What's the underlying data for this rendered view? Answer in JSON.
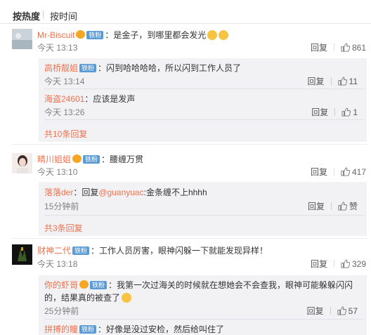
{
  "tabs": {
    "hot": "按热度",
    "time": "按时间"
  },
  "icons": {
    "like": "thumbs-up-icon",
    "verified": "vip-badge-icon",
    "emoji": "emoji-icon"
  },
  "colors": {
    "username": "#eb7350",
    "badge": "#5b9bd5",
    "reply_bg": "#f2f2f5"
  },
  "comments": [
    {
      "user": "Mr-Biscuit",
      "badge": "铁粉",
      "text": "：是金子，到哪里都会发光",
      "time": "今天 13:13",
      "reply": "回复",
      "likes": "861",
      "replies": [
        {
          "user": "高桥靓姐",
          "badge": "铁粉",
          "text": "：闪到哈哈哈哈，所以闪到工作人员了",
          "time": "今天 13:14",
          "reply": "回复",
          "likes": "11"
        },
        {
          "user": "海盗24601",
          "badge": "",
          "text": "：应该是发声",
          "time": "今天 13:26",
          "reply": "回复",
          "likes": "1"
        }
      ],
      "more": "共10条回复"
    },
    {
      "user": "晴川姐姐",
      "badge": "铁粉",
      "text": "：腰缠万贯",
      "time": "今天 13:10",
      "reply": "回复",
      "likes": "417",
      "replies": [
        {
          "user": "落落der",
          "badge": "",
          "prefix": "：回复",
          "mention": "@guanyuac",
          "text": ":金条缠不上hhhh",
          "time": "15分钟前",
          "reply": "回复",
          "likes": "赞"
        }
      ],
      "more": "共3条回复"
    },
    {
      "user": "财神二代",
      "badge": "铁粉",
      "text": "：工作人员厉害，眼神闪躲一下就能发现异样！",
      "time": "今天 13:18",
      "reply": "回复",
      "likes": "329",
      "replies": [
        {
          "user": "你的虾哥",
          "badge": "铁粉",
          "text": "：我第一次过海关的时候就在想她会不会查我，眼神可能躲躲闪闪",
          "text2": "的，结果真的被查了",
          "time": "25分钟前",
          "reply": "回复",
          "likes": "57"
        },
        {
          "user": "拼搏的瞳",
          "badge": "铁粉",
          "text": "：好像是没过安检，然后给叫住了"
        }
      ]
    }
  ]
}
